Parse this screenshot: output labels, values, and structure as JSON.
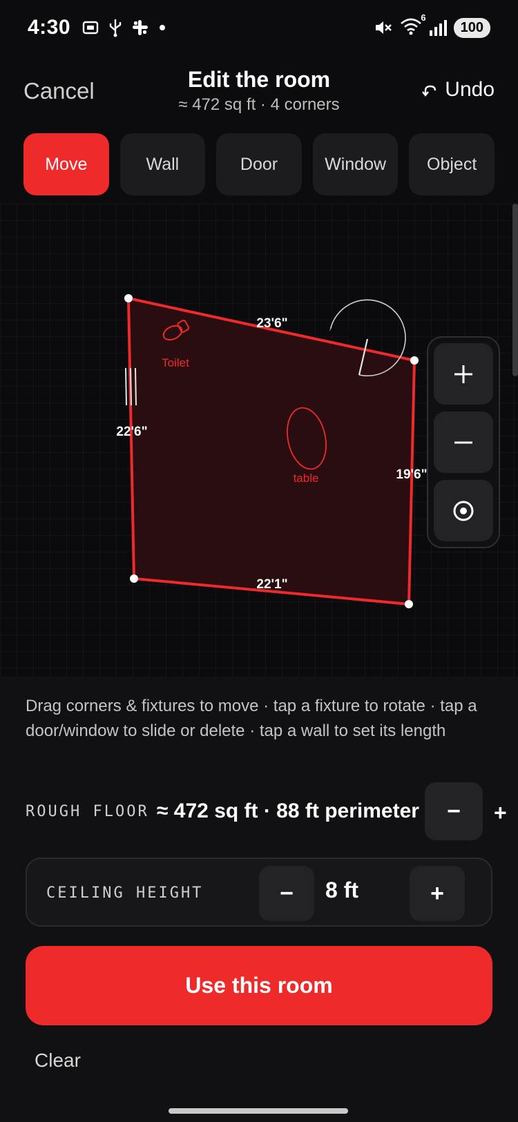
{
  "status_bar": {
    "time": "4:30",
    "left_icons": [
      "screenshot-icon",
      "usb-icon",
      "slack-icon",
      "dot-icon"
    ],
    "right_icons": [
      "mute-icon",
      "wifi-icon",
      "signal-icon"
    ],
    "wifi_badge": "6",
    "battery": "100"
  },
  "header": {
    "cancel_label": "Cancel",
    "title": "Edit the room",
    "subtitle": "≈ 472 sq ft · 4 corners",
    "undo_label": "Undo"
  },
  "tool_tabs": [
    {
      "label": "Move",
      "active": true
    },
    {
      "label": "Wall",
      "active": false
    },
    {
      "label": "Door",
      "active": false
    },
    {
      "label": "Window",
      "active": false
    },
    {
      "label": "Object",
      "active": false
    }
  ],
  "floor_plan": {
    "walls": [
      {
        "label": "23'6\""
      },
      {
        "label": "19'6\""
      },
      {
        "label": "22'1\""
      },
      {
        "label": "22'6\""
      }
    ],
    "fixtures": [
      {
        "label": "Toilet",
        "icon": "toilet-icon"
      },
      {
        "label": "table",
        "icon": "table-icon"
      }
    ],
    "colors": {
      "wall": "#ee2a2b",
      "fill": "#2a0d10",
      "corner": "#ffffff",
      "label": "#ffffff"
    }
  },
  "zoom_controls": {
    "icons": [
      "plus-icon",
      "minus-icon",
      "recenter-icon"
    ]
  },
  "help_text": "Drag corners & fixtures to move · tap a fixture to rotate · tap a door/window to slide or delete · tap a wall to set its length",
  "rough_floor": {
    "label": "ROUGH FLOOR",
    "value": "≈ 472 sq ft · 88 ft perimeter",
    "minus": "−",
    "plus": "+"
  },
  "ceiling": {
    "label": "CEILING HEIGHT",
    "minus": "−",
    "value": "8 ft",
    "plus": "+"
  },
  "primary_action": "Use this room",
  "secondary_action": "Clear",
  "accent_color": "#ee2a2b"
}
